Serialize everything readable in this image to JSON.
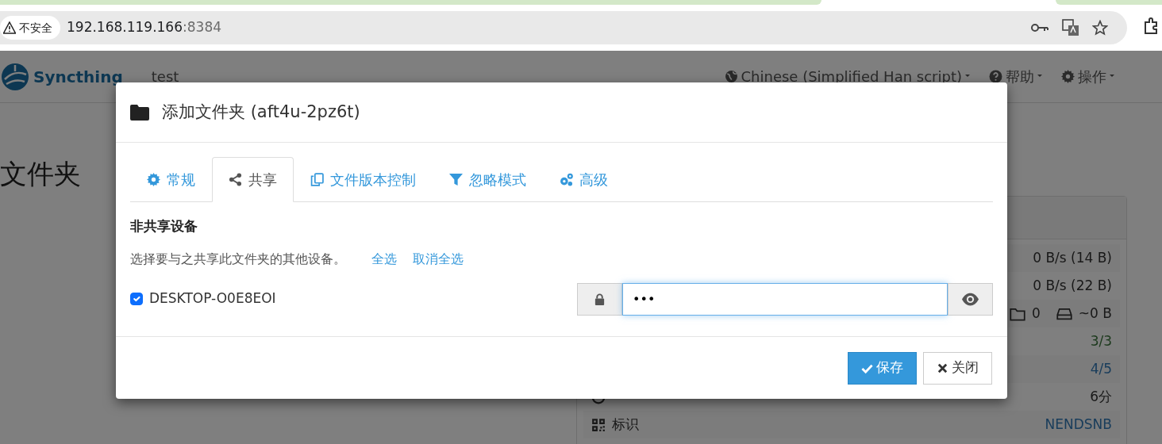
{
  "browser": {
    "security_label": "不安全",
    "url_host": "192.168.119.166",
    "url_port": ":8384"
  },
  "navbar": {
    "brand": "Syncthing",
    "device_name": "test",
    "menus": [
      {
        "label": "Chinese (Simplified Han script)"
      },
      {
        "label": "帮助"
      },
      {
        "label": "操作"
      }
    ]
  },
  "page_heading": "文件夹",
  "status_panel": {
    "rows": [
      {
        "kind": "value",
        "value": "0 B/s (14 B)"
      },
      {
        "kind": "value",
        "value": "0 B/s (22 B)"
      },
      {
        "kind": "counts",
        "folders": "0",
        "size": "~0 B"
      },
      {
        "kind": "success",
        "value": "3/3"
      },
      {
        "kind": "link",
        "value": "4/5"
      },
      {
        "kind": "labeled",
        "value": "6分"
      },
      {
        "kind": "labeled-link",
        "label": "标识",
        "value": "NENDSNB"
      }
    ]
  },
  "modal": {
    "title": "添加文件夹 (aft4u-2pz6t)",
    "tabs": [
      {
        "label": "常规",
        "selected": false
      },
      {
        "label": "共享",
        "selected": true
      },
      {
        "label": "文件版本控制",
        "selected": false
      },
      {
        "label": "忽略模式",
        "selected": false
      },
      {
        "label": "高级",
        "selected": false
      }
    ],
    "section_heading": "非共享设备",
    "hint": "选择要与之共享此文件夹的其他设备。",
    "select_all": "全选",
    "deselect_all": "取消全选",
    "devices": [
      {
        "name": "DESKTOP-O0E8EOI",
        "checked": true,
        "password_value": "•••"
      }
    ],
    "buttons": [
      {
        "kind": "primary",
        "label": "保存"
      },
      {
        "kind": "default",
        "label": "关闭"
      }
    ]
  }
}
